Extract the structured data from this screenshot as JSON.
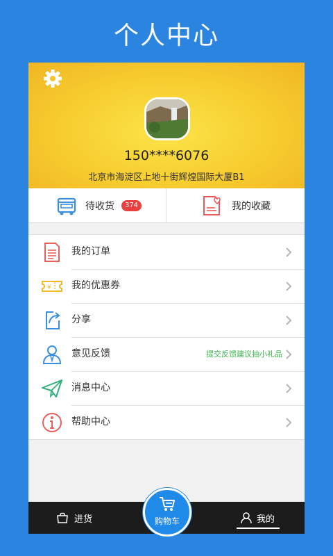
{
  "banner": {
    "title": "个人中心"
  },
  "profile": {
    "phone": "150****6076",
    "address": "北京市海淀区上地十街辉煌国际大厦B1"
  },
  "quick_actions": {
    "pending": {
      "label": "待收货",
      "badge": "374",
      "icon": "truck-icon"
    },
    "favorites": {
      "label": "我的收藏",
      "icon": "heart-document-icon"
    }
  },
  "menu": {
    "items": [
      {
        "label": "我的订单",
        "icon": "order-document-icon",
        "hint": ""
      },
      {
        "label": "我的优惠券",
        "icon": "coupon-icon",
        "hint": ""
      },
      {
        "label": "分享",
        "icon": "share-icon",
        "hint": ""
      },
      {
        "label": "意见反馈",
        "icon": "user-feedback-icon",
        "hint": "提交反馈建议抽小礼品"
      },
      {
        "label": "消息中心",
        "icon": "paper-plane-icon",
        "hint": ""
      },
      {
        "label": "帮助中心",
        "icon": "info-icon",
        "hint": ""
      }
    ]
  },
  "tabbar": {
    "left": {
      "label": "进货",
      "icon": "bag-icon"
    },
    "center": {
      "label": "购物车",
      "icon": "cart-icon"
    },
    "right": {
      "label": "我的",
      "icon": "person-icon"
    }
  },
  "colors": {
    "background": "#2a84e0",
    "header_yellow": "#f7cc2e",
    "badge_red": "#e8403e",
    "hint_green": "#39b54a",
    "tabbar": "#1c1c1c"
  }
}
